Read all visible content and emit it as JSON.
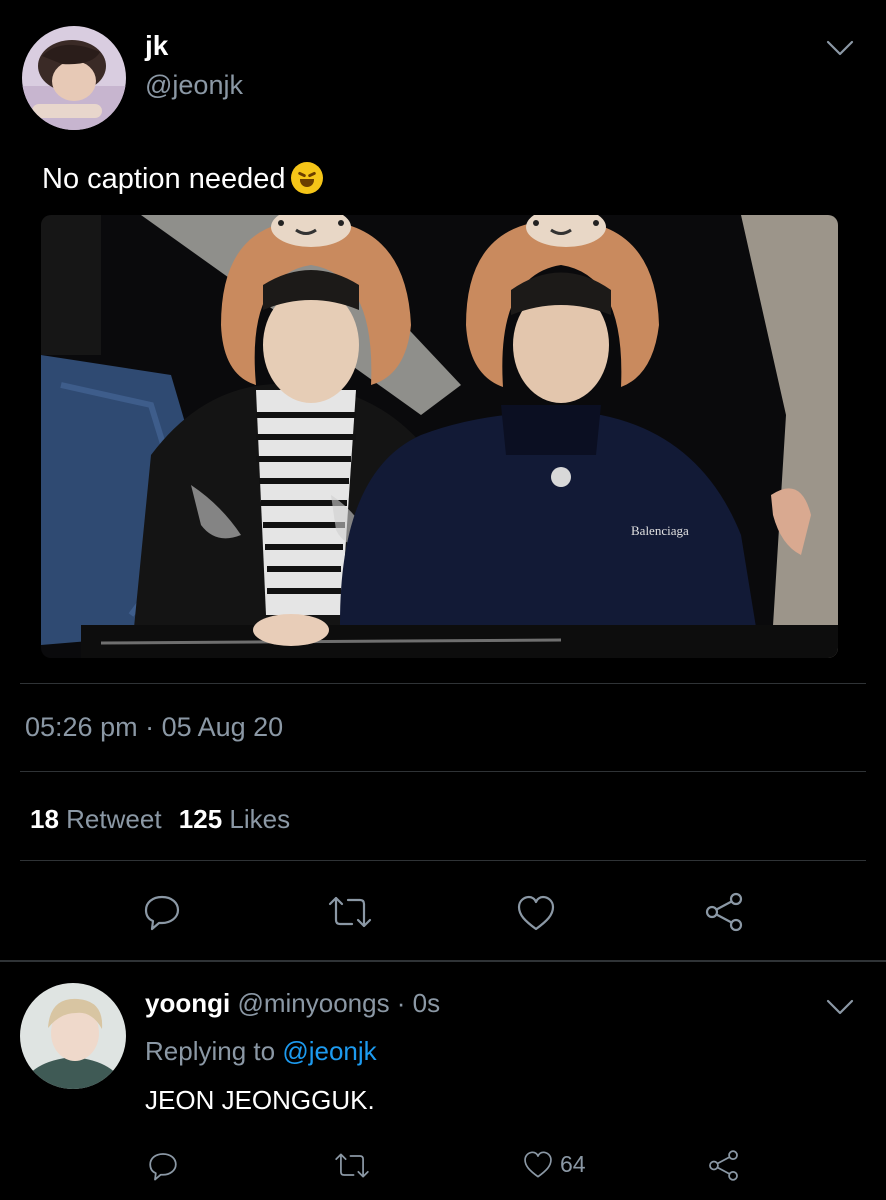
{
  "tweet": {
    "display_name": "jk",
    "handle": "@jeonjk",
    "text": "No caption needed",
    "emoji_icon": "rolling-on-floor-laughing-emoji",
    "timestamp": "05:26 pm · 05 Aug 20",
    "stats": {
      "retweets_count": "18",
      "retweets_label": "Retweet",
      "likes_count": "125",
      "likes_label": "Likes"
    }
  },
  "reply": {
    "display_name": "yoongi",
    "handle_time": "@minyoongs · 0s",
    "replying_prefix": "Replying to",
    "replying_to": "@jeonjk",
    "text": "JEON JEONGGUK.",
    "likes": "64"
  },
  "colors": {
    "background": "#000000",
    "muted": "#8b98a5",
    "link": "#1d9bf0",
    "divider": "#2f3336"
  }
}
